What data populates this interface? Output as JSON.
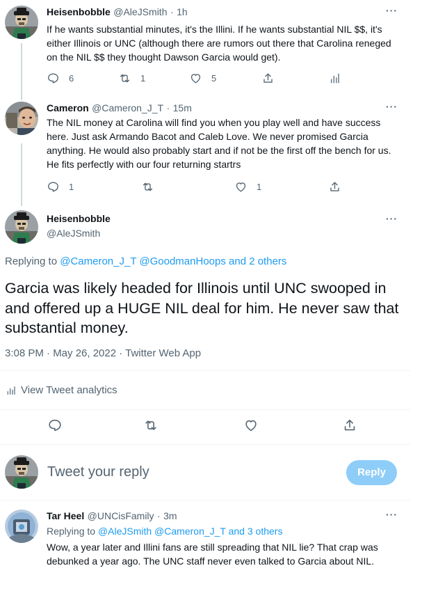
{
  "tweet1": {
    "display_name": "Heisenbobble",
    "handle": "@AleJSmith",
    "separator": "·",
    "time": "1h",
    "text": "If he wants substantial minutes, it's the Illini. If he wants substantial NIL $$, it's either Illinois or UNC (although there are rumors out there that Carolina reneged on the NIL $$ they thought Dawson Garcia would get).",
    "replies": "6",
    "retweets": "1",
    "likes": "5"
  },
  "tweet2": {
    "display_name": "Cameron",
    "handle": "@Cameron_J_T",
    "separator": "·",
    "time": "15m",
    "text": "The NIL money at Carolina will find you when you play well and have success here. Just ask Armando Bacot and Caleb Love. We never promised Garcia anything. He would also probably start and if not be the first off the bench for us. He fits perfectly with our four returning startrs",
    "replies": "1",
    "retweets": "",
    "likes": "1"
  },
  "main_tweet": {
    "display_name": "Heisenbobble",
    "handle": "@AleJSmith",
    "replying_prefix": "Replying to",
    "replying_to": "@Cameron_J_T @GoodmanHoops and 2 others",
    "text": "Garcia was likely headed for Illinois until UNC swooped in and offered up a HUGE NIL deal for him. He never saw that substantial money.",
    "timestamp": "3:08 PM · May 26, 2022 · Twitter Web App",
    "analytics_label": "View Tweet analytics"
  },
  "composer": {
    "placeholder": "Tweet your reply",
    "reply_button": "Reply"
  },
  "tweet3": {
    "display_name": "Tar Heel",
    "handle": "@UNCisFamily",
    "separator": "·",
    "time": "3m",
    "replying_prefix": "Replying to",
    "replying_to": "@AleJSmith @Cameron_J_T and 3 others",
    "text": "Wow, a year later and Illini fans are still spreading that NIL lie?  That crap was debunked a year ago. The UNC staff never even talked to Garcia about NIL."
  },
  "more_glyph": "···",
  "colors": {
    "accent": "#1d9bf0",
    "reply_button_disabled": "#8ecdf8",
    "muted": "#536471",
    "divider": "#eff3f4"
  },
  "icons": [
    "reply-icon",
    "retweet-icon",
    "like-icon",
    "share-icon",
    "analytics-icon",
    "more-icon"
  ]
}
